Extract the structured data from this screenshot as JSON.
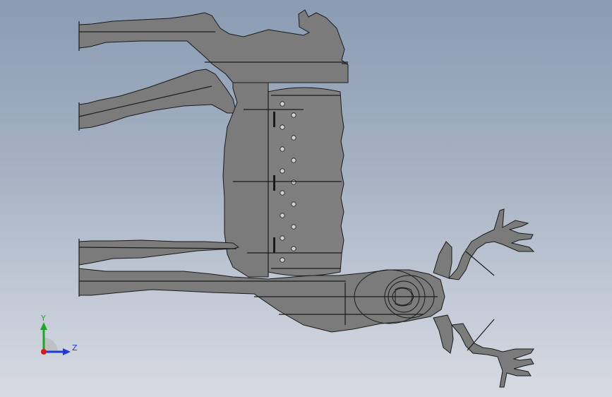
{
  "viewport": {
    "background_top": "#8a9bb2",
    "background_bottom": "#d6dae2"
  },
  "model": {
    "part_fill": "#7b7b7b",
    "edge_color": "#1a1a1a",
    "hole_fill": "#d2d2d2"
  },
  "triad": {
    "y_label": "Y",
    "z_label": "Z",
    "x_color": "#d41c1c",
    "y_color": "#22a32f",
    "z_color": "#1f3bd6"
  }
}
